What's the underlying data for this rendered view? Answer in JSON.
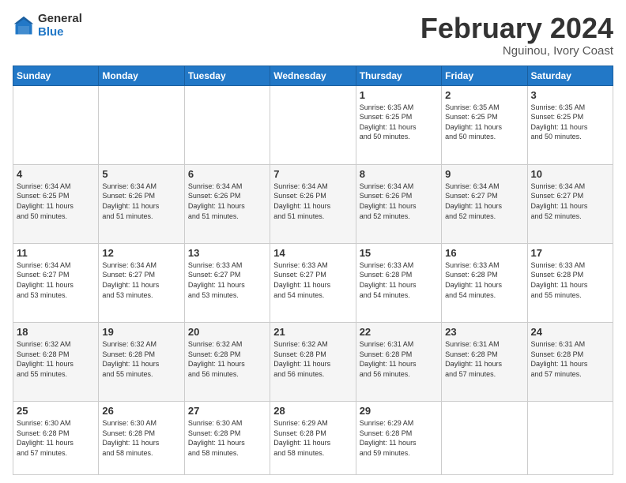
{
  "logo": {
    "general": "General",
    "blue": "Blue"
  },
  "header": {
    "month": "February 2024",
    "location": "Nguinou, Ivory Coast"
  },
  "weekdays": [
    "Sunday",
    "Monday",
    "Tuesday",
    "Wednesday",
    "Thursday",
    "Friday",
    "Saturday"
  ],
  "weeks": [
    {
      "days": [
        {
          "num": "",
          "info": ""
        },
        {
          "num": "",
          "info": ""
        },
        {
          "num": "",
          "info": ""
        },
        {
          "num": "",
          "info": ""
        },
        {
          "num": "1",
          "info": "Sunrise: 6:35 AM\nSunset: 6:25 PM\nDaylight: 11 hours\nand 50 minutes."
        },
        {
          "num": "2",
          "info": "Sunrise: 6:35 AM\nSunset: 6:25 PM\nDaylight: 11 hours\nand 50 minutes."
        },
        {
          "num": "3",
          "info": "Sunrise: 6:35 AM\nSunset: 6:25 PM\nDaylight: 11 hours\nand 50 minutes."
        }
      ]
    },
    {
      "days": [
        {
          "num": "4",
          "info": "Sunrise: 6:34 AM\nSunset: 6:25 PM\nDaylight: 11 hours\nand 50 minutes."
        },
        {
          "num": "5",
          "info": "Sunrise: 6:34 AM\nSunset: 6:26 PM\nDaylight: 11 hours\nand 51 minutes."
        },
        {
          "num": "6",
          "info": "Sunrise: 6:34 AM\nSunset: 6:26 PM\nDaylight: 11 hours\nand 51 minutes."
        },
        {
          "num": "7",
          "info": "Sunrise: 6:34 AM\nSunset: 6:26 PM\nDaylight: 11 hours\nand 51 minutes."
        },
        {
          "num": "8",
          "info": "Sunrise: 6:34 AM\nSunset: 6:26 PM\nDaylight: 11 hours\nand 52 minutes."
        },
        {
          "num": "9",
          "info": "Sunrise: 6:34 AM\nSunset: 6:27 PM\nDaylight: 11 hours\nand 52 minutes."
        },
        {
          "num": "10",
          "info": "Sunrise: 6:34 AM\nSunset: 6:27 PM\nDaylight: 11 hours\nand 52 minutes."
        }
      ]
    },
    {
      "days": [
        {
          "num": "11",
          "info": "Sunrise: 6:34 AM\nSunset: 6:27 PM\nDaylight: 11 hours\nand 53 minutes."
        },
        {
          "num": "12",
          "info": "Sunrise: 6:34 AM\nSunset: 6:27 PM\nDaylight: 11 hours\nand 53 minutes."
        },
        {
          "num": "13",
          "info": "Sunrise: 6:33 AM\nSunset: 6:27 PM\nDaylight: 11 hours\nand 53 minutes."
        },
        {
          "num": "14",
          "info": "Sunrise: 6:33 AM\nSunset: 6:27 PM\nDaylight: 11 hours\nand 54 minutes."
        },
        {
          "num": "15",
          "info": "Sunrise: 6:33 AM\nSunset: 6:28 PM\nDaylight: 11 hours\nand 54 minutes."
        },
        {
          "num": "16",
          "info": "Sunrise: 6:33 AM\nSunset: 6:28 PM\nDaylight: 11 hours\nand 54 minutes."
        },
        {
          "num": "17",
          "info": "Sunrise: 6:33 AM\nSunset: 6:28 PM\nDaylight: 11 hours\nand 55 minutes."
        }
      ]
    },
    {
      "days": [
        {
          "num": "18",
          "info": "Sunrise: 6:32 AM\nSunset: 6:28 PM\nDaylight: 11 hours\nand 55 minutes."
        },
        {
          "num": "19",
          "info": "Sunrise: 6:32 AM\nSunset: 6:28 PM\nDaylight: 11 hours\nand 55 minutes."
        },
        {
          "num": "20",
          "info": "Sunrise: 6:32 AM\nSunset: 6:28 PM\nDaylight: 11 hours\nand 56 minutes."
        },
        {
          "num": "21",
          "info": "Sunrise: 6:32 AM\nSunset: 6:28 PM\nDaylight: 11 hours\nand 56 minutes."
        },
        {
          "num": "22",
          "info": "Sunrise: 6:31 AM\nSunset: 6:28 PM\nDaylight: 11 hours\nand 56 minutes."
        },
        {
          "num": "23",
          "info": "Sunrise: 6:31 AM\nSunset: 6:28 PM\nDaylight: 11 hours\nand 57 minutes."
        },
        {
          "num": "24",
          "info": "Sunrise: 6:31 AM\nSunset: 6:28 PM\nDaylight: 11 hours\nand 57 minutes."
        }
      ]
    },
    {
      "days": [
        {
          "num": "25",
          "info": "Sunrise: 6:30 AM\nSunset: 6:28 PM\nDaylight: 11 hours\nand 57 minutes."
        },
        {
          "num": "26",
          "info": "Sunrise: 6:30 AM\nSunset: 6:28 PM\nDaylight: 11 hours\nand 58 minutes."
        },
        {
          "num": "27",
          "info": "Sunrise: 6:30 AM\nSunset: 6:28 PM\nDaylight: 11 hours\nand 58 minutes."
        },
        {
          "num": "28",
          "info": "Sunrise: 6:29 AM\nSunset: 6:28 PM\nDaylight: 11 hours\nand 58 minutes."
        },
        {
          "num": "29",
          "info": "Sunrise: 6:29 AM\nSunset: 6:28 PM\nDaylight: 11 hours\nand 59 minutes."
        },
        {
          "num": "",
          "info": ""
        },
        {
          "num": "",
          "info": ""
        }
      ]
    }
  ]
}
